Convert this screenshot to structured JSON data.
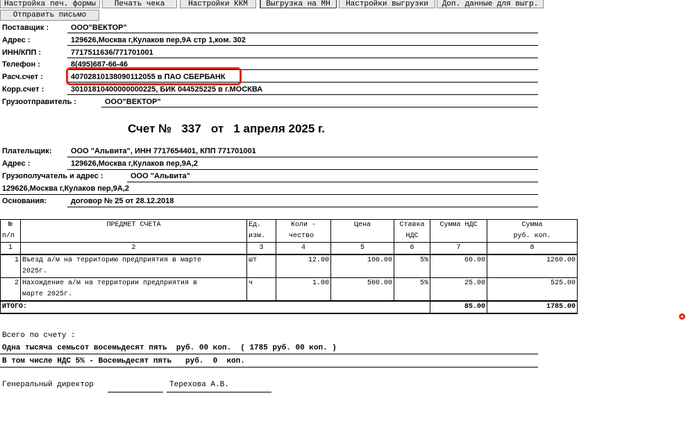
{
  "toolbar": {
    "print_form_settings": "Настройка печ. формы",
    "print_receipt": "Печать чека",
    "kkm_settings": "Настройки ККМ",
    "export_mn": "Выгрузка на МН",
    "export_settings": "Настройки выгрузки",
    "extra_export_data": "Доп. данные для выгр.",
    "send_email": "Отправить письмо"
  },
  "supplier": {
    "supplier_label": "Поставщик :",
    "supplier_value": "ООО\"ВЕКТОР\"",
    "address_label": "Адрес    :",
    "address_value": "129626,Москва г,Кулаков пер,9А стр 1,ком. 302",
    "inn_label": "ИНН/КПП   :",
    "inn_value": "7717511636/771701001",
    "phone_label": "Телефон :",
    "phone_value": "8(495)687-66-46",
    "account_label": "Расч.счет :",
    "account_value": "40702810138090112055 в ПАО СБЕРБАНК",
    "corr_label": "Корр.счет :",
    "corr_value": "30101810400000000225, БИК 044525225 в г.МОСКВА",
    "shipper_label": "Грузоотправитель :",
    "shipper_value": "ООО\"ВЕКТОР\""
  },
  "invoice": {
    "title": "Счет №   337   от   1 апреля 2025 г."
  },
  "payer": {
    "payer_label": "Плательщик:",
    "payer_value": "ООО \"Альвита\", ИНН 7717654401, КПП 771701001",
    "address_label": "Адрес    :",
    "address_value": "129626,Москва г,Кулаков пер,9А,2",
    "consignee_label": "Грузополучатель и адрес :",
    "consignee_value": "ООО \"Альвита\"",
    "consignee_address": "129626,Москва г,Кулаков пер,9А,2",
    "basis_label": "Основания:",
    "basis_value": "договор № 25 от 28.12.2018"
  },
  "table": {
    "h_num": "№",
    "h_num2": "п/п",
    "h_subject": "ПРЕДМЕТ СЧЕТА",
    "h_unit": "Ед.",
    "h_unit2": "изм.",
    "h_qty": "Коли -",
    "h_qty2": "чество",
    "h_price": "Цена",
    "h_rate": "Ставка",
    "h_rate2": "НДС",
    "h_vat": "Сумма НДС",
    "h_sum": "Сумма",
    "h_sum2": "руб.  коп.",
    "idx": [
      "1",
      "2",
      "3",
      "4",
      "5",
      "6",
      "7",
      "8"
    ],
    "rows": [
      {
        "n": "1",
        "name1": "Въезд а/м на территорию предприятия  в марте",
        "name2": "2025г.",
        "unit": "шт",
        "qty": "12.00",
        "price": "100.00",
        "rate": "5%",
        "vat": "60.00",
        "sum": "1260.00"
      },
      {
        "n": "2",
        "name1": "Нахождение а/м на территории предприятия  в",
        "name2": "марте 2025г.",
        "unit": "ч",
        "qty": "1.00",
        "price": "500.00",
        "rate": "5%",
        "vat": "25.00",
        "sum": "525.00"
      }
    ],
    "total_label": "ИТОГО:",
    "total_vat": "85.00",
    "total_sum": "1785.00"
  },
  "summary": {
    "total_caption": "Всего по счету :",
    "total_words": "Одна тысяча семьсот восемьдесят пять  руб. 00 коп.  ( 1785 руб. 00 коп. )",
    "vat_words": "В том числе НДС 5% - Восемьдесят пять   руб.  0  коп."
  },
  "signature": {
    "position": "Генеральный директор",
    "name": "Терехова А.В."
  },
  "colors": {
    "highlight": "#e0261b"
  }
}
